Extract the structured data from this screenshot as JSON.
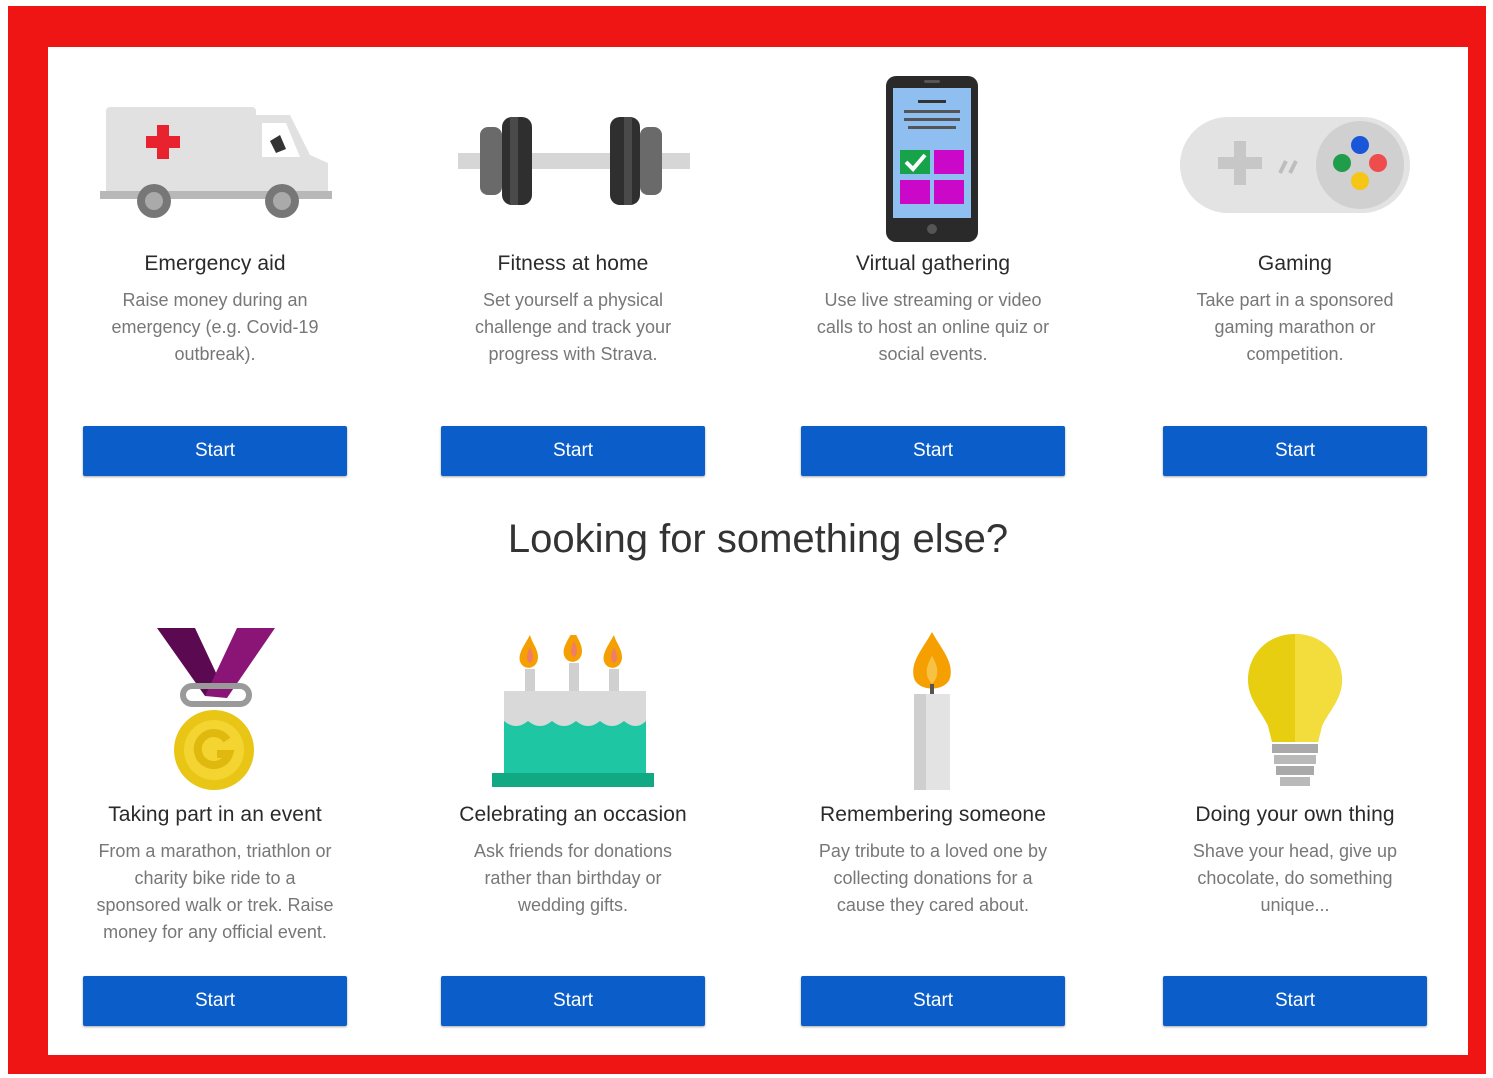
{
  "colors": {
    "frame": "#ef1515",
    "button": "#0b5dca",
    "title": "#2a2a2a",
    "description": "#777777"
  },
  "top_cards": [
    {
      "icon": "ambulance-icon",
      "title": "Emergency aid",
      "desc": [
        "Raise money during an",
        "emergency (e.g. Covid-19",
        "outbreak)."
      ],
      "button": "Start"
    },
    {
      "icon": "dumbbell-icon",
      "title": "Fitness at home",
      "desc": [
        "Set yourself a physical",
        "challenge and track your",
        "progress with Strava."
      ],
      "button": "Start"
    },
    {
      "icon": "smartphone-icon",
      "title": "Virtual gathering",
      "desc": [
        "Use live streaming or video",
        "calls to host an online quiz or",
        "social events."
      ],
      "button": "Start"
    },
    {
      "icon": "gamepad-icon",
      "title": "Gaming",
      "desc": [
        "Take part in a sponsored",
        "gaming marathon or",
        "competition."
      ],
      "button": "Start"
    }
  ],
  "section_heading": "Looking for something else?",
  "bottom_cards": [
    {
      "icon": "medal-icon",
      "title": "Taking part in an event",
      "desc": [
        "From a marathon, triathlon or",
        "charity bike ride to a",
        "sponsored walk or trek. Raise",
        "money for any official event."
      ],
      "button": "Start"
    },
    {
      "icon": "birthday-cake-icon",
      "title": "Celebrating an occasion",
      "desc": [
        "Ask friends for donations",
        "rather than birthday or",
        "wedding gifts."
      ],
      "button": "Start"
    },
    {
      "icon": "candle-icon",
      "title": "Remembering someone",
      "desc": [
        "Pay tribute to a loved one by",
        "collecting donations for a",
        "cause they cared about."
      ],
      "button": "Start"
    },
    {
      "icon": "lightbulb-icon",
      "title": "Doing your own thing",
      "desc": [
        "Shave your head, give up",
        "chocolate, do something",
        "unique..."
      ],
      "button": "Start"
    }
  ]
}
